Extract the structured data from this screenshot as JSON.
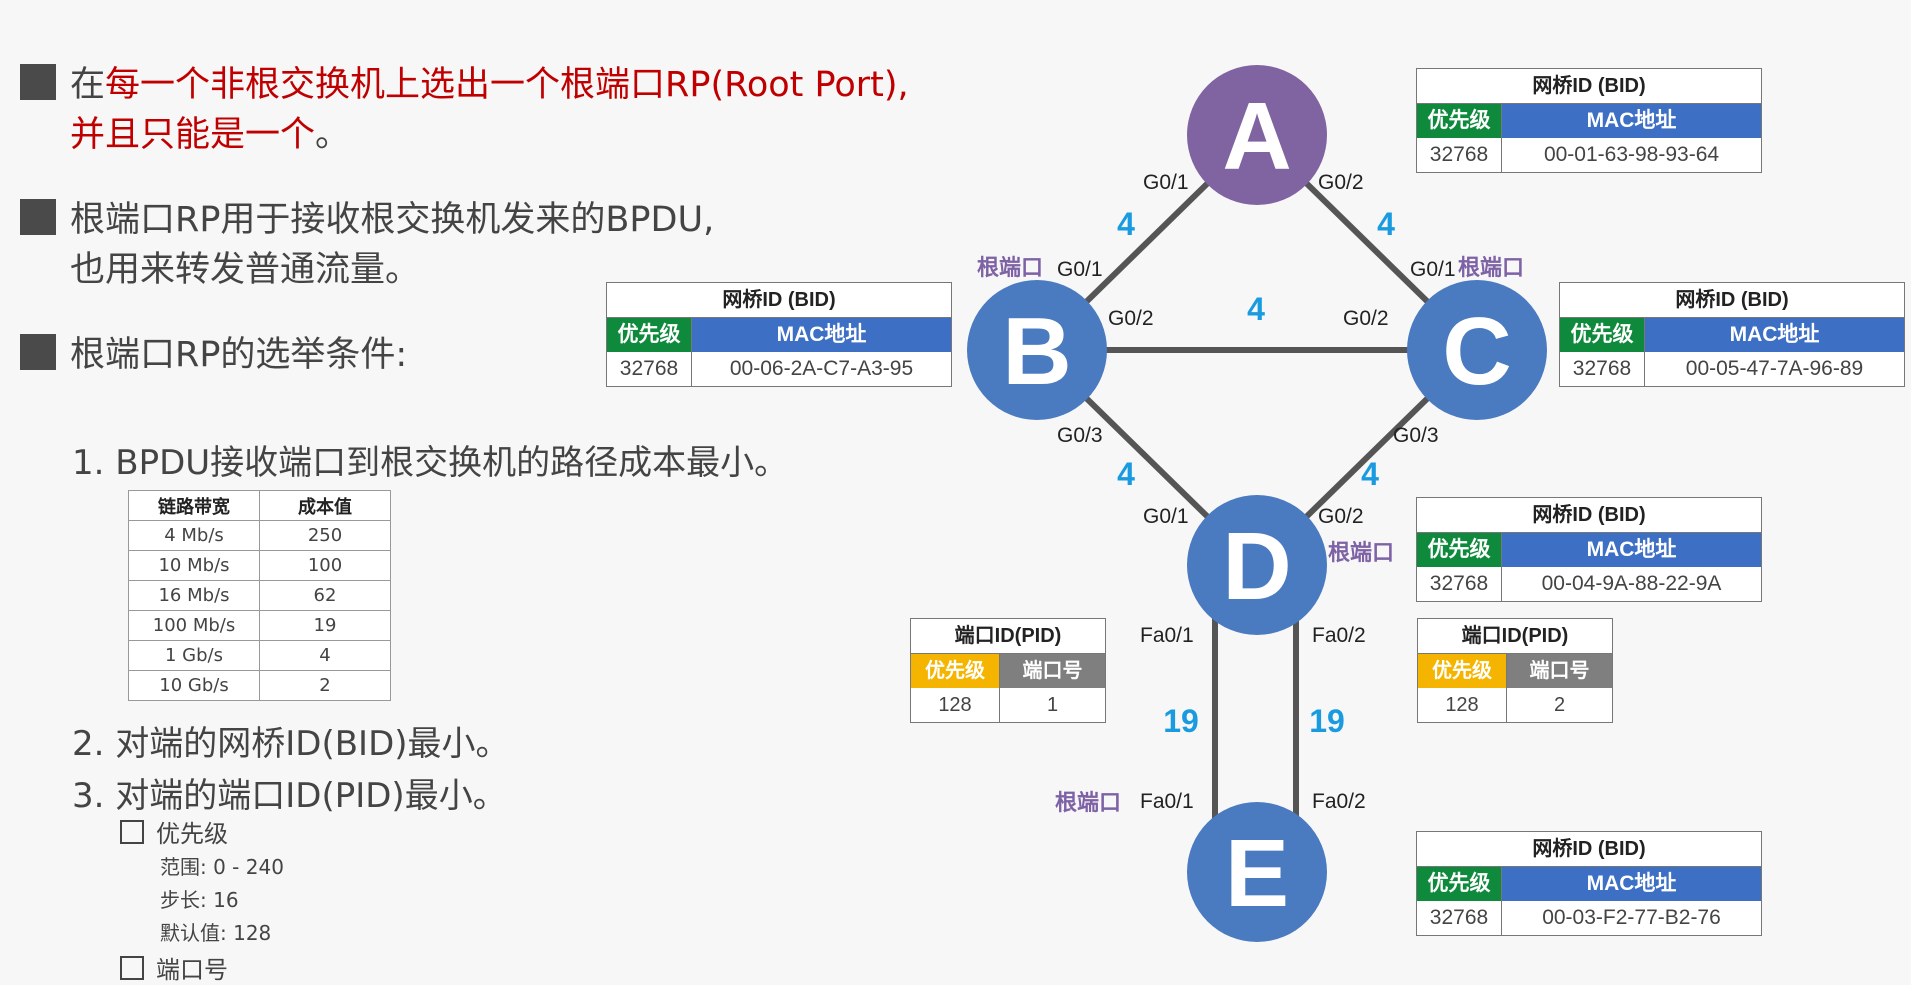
{
  "bullets": {
    "b1_pre": "在",
    "b1_red1": "每一个非根交换机上选出一个根端口RP(Root Port),",
    "b1_red2": "并且只能是一个",
    "b1_post": "。",
    "b2_line1": "根端口RP用于接收根交换机发来的BPDU,",
    "b2_line2": "也用来转发普通流量。",
    "b3": "根端口RP的选举条件:"
  },
  "conditions": {
    "c1": "1. BPDU接收端口到根交换机的路径成本最小。",
    "c2": "2. 对端的网桥ID(BID)最小。",
    "c3": "3. 对端的端口ID(PID)最小。"
  },
  "cost_table": {
    "headers": [
      "链路带宽",
      "成本值"
    ],
    "rows": [
      [
        "4 Mb/s",
        "250"
      ],
      [
        "10 Mb/s",
        "100"
      ],
      [
        "16 Mb/s",
        "62"
      ],
      [
        "100 Mb/s",
        "19"
      ],
      [
        "1 Gb/s",
        "4"
      ],
      [
        "10 Gb/s",
        "2"
      ]
    ]
  },
  "pid_notes": {
    "priority_label": "优先级",
    "range": "范围: 0 - 240",
    "step": "步长: 16",
    "default": "默认值: 128",
    "port_label": "端口号"
  },
  "colors": {
    "root_switch": "#8063a1",
    "switch": "#4a7ac0",
    "link": "#555555",
    "cost": "#1a9be0",
    "root_port": "#7e62a6",
    "priority_header": "#0f8a3c",
    "mac_header": "#3d6fc4",
    "pid_priority_header": "#f5b400",
    "pid_port_header": "#7f7f7f",
    "title_red": "#c00000"
  },
  "switches": {
    "A": {
      "label": "A"
    },
    "B": {
      "label": "B"
    },
    "C": {
      "label": "C"
    },
    "D": {
      "label": "D"
    },
    "E": {
      "label": "E"
    }
  },
  "bid_tables": {
    "A": {
      "title": "网桥ID (BID)",
      "col1": "优先级",
      "col2": "MAC地址",
      "priority": "32768",
      "mac": "00-01-63-98-93-64"
    },
    "B": {
      "title": "网桥ID (BID)",
      "col1": "优先级",
      "col2": "MAC地址",
      "priority": "32768",
      "mac": "00-06-2A-C7-A3-95"
    },
    "C": {
      "title": "网桥ID (BID)",
      "col1": "优先级",
      "col2": "MAC地址",
      "priority": "32768",
      "mac": "00-05-47-7A-96-89"
    },
    "D": {
      "title": "网桥ID (BID)",
      "col1": "优先级",
      "col2": "MAC地址",
      "priority": "32768",
      "mac": "00-04-9A-88-22-9A"
    },
    "E": {
      "title": "网桥ID (BID)",
      "col1": "优先级",
      "col2": "MAC地址",
      "priority": "32768",
      "mac": "00-03-F2-77-B2-76"
    }
  },
  "pid_tables": {
    "left": {
      "title": "端口ID(PID)",
      "col1": "优先级",
      "col2": "端口号",
      "priority": "128",
      "port": "1"
    },
    "right": {
      "title": "端口ID(PID)",
      "col1": "优先级",
      "col2": "端口号",
      "priority": "128",
      "port": "2"
    }
  },
  "links": [
    {
      "from": "A",
      "to": "B",
      "cost": "4"
    },
    {
      "from": "A",
      "to": "C",
      "cost": "4"
    },
    {
      "from": "B",
      "to": "C",
      "cost": "4"
    },
    {
      "from": "B",
      "to": "D",
      "cost": "4"
    },
    {
      "from": "C",
      "to": "D",
      "cost": "4"
    },
    {
      "from": "D",
      "to": "E",
      "cost": "19"
    },
    {
      "from": "D",
      "to": "E",
      "cost": "19"
    }
  ],
  "ports": {
    "a_g01": "G0/1",
    "a_g02": "G0/2",
    "b_g01": "G0/1",
    "b_g02": "G0/2",
    "b_g03": "G0/3",
    "c_g01": "G0/1",
    "c_g02": "G0/2",
    "c_g03": "G0/3",
    "d_g01": "G0/1",
    "d_g02": "G0/2",
    "d_fa01": "Fa0/1",
    "d_fa02": "Fa0/2",
    "e_fa01": "Fa0/1",
    "e_fa02": "Fa0/2"
  },
  "root_port_label": "根端口"
}
